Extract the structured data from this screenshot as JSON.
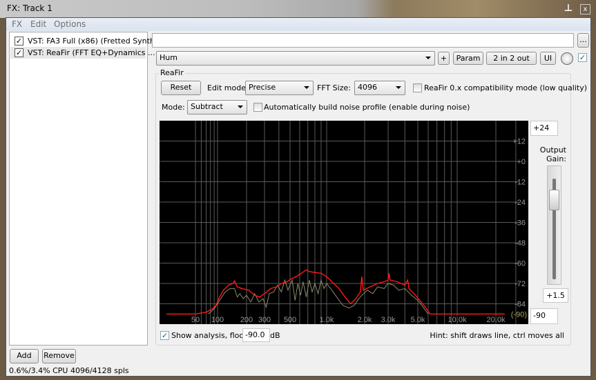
{
  "window": {
    "title": "FX: Track 1",
    "pin_icon": "pin-icon",
    "close_icon": "close-icon"
  },
  "menu": [
    "FX",
    "Edit",
    "Options"
  ],
  "fx_chain": [
    {
      "label": "VST: FA3 Full (x86) (Fretted Synth)",
      "enabled": true
    },
    {
      "label": "VST: ReaFir (FFT EQ+Dynamics ...",
      "enabled": true,
      "selected": true
    }
  ],
  "buttons": {
    "add": "Add",
    "remove": "Remove",
    "more": "...",
    "plus": "+",
    "param": "Param",
    "io": "2 in 2 out",
    "ui": "UI"
  },
  "preset_name": "",
  "preset": "Hum",
  "plugin_enabled": true,
  "reafir": {
    "group_label": "ReaFir",
    "reset": "Reset",
    "edit_mode_label": "Edit mode:",
    "edit_mode": "Precise",
    "fft_size_label": "FFT Size:",
    "fft_size": "4096",
    "compat_label": "ReaFir 0.x compatibility mode (low quality)",
    "compat_checked": false,
    "mode_label": "Mode:",
    "mode": "Subtract",
    "auto_noise_label": "Automatically build noise profile (enable during noise)",
    "auto_noise_checked": false,
    "range_top": "+24",
    "range_bottom": "-90",
    "output_gain_label": "Output Gain:",
    "output_gain": "+1.5",
    "output_gain_db": 1.5,
    "show_analysis_label": "Show analysis, floor:",
    "show_analysis_checked": true,
    "floor": "-90.0",
    "floor_unit": "dB",
    "hint": "Hint: shift draws line, ctrl moves all"
  },
  "chart_data": {
    "type": "line",
    "x_scale": "log",
    "x_ticks": [
      "50",
      "100",
      "200",
      "300",
      "500",
      "1.0k",
      "2.0k",
      "3.0k",
      "5.0k",
      "10.0k",
      "20.0k"
    ],
    "y_ticks": [
      "+12",
      "+0",
      "-12",
      "-24",
      "-36",
      "-48",
      "-60",
      "-72",
      "-84"
    ],
    "floor_label": "(-90)",
    "ylim": [
      -96,
      24
    ],
    "grid": true,
    "colors": {
      "background": "#000000",
      "grid": "#5a5a5a",
      "eq_curve": "#ff1a1a",
      "analysis": "#8c8a6e",
      "floor_label": "#a8a060"
    },
    "series": [
      {
        "key": "eq_curve",
        "points": [
          [
            20,
            -90
          ],
          [
            50,
            -90
          ],
          [
            70,
            -89
          ],
          [
            85,
            -87
          ],
          [
            95,
            -85
          ],
          [
            105,
            -80
          ],
          [
            115,
            -76
          ],
          [
            130,
            -73
          ],
          [
            145,
            -72
          ],
          [
            150,
            -70.5
          ],
          [
            160,
            -74
          ],
          [
            180,
            -75
          ],
          [
            210,
            -76
          ],
          [
            240,
            -79
          ],
          [
            270,
            -80
          ],
          [
            300,
            -78
          ],
          [
            340,
            -75
          ],
          [
            380,
            -74
          ],
          [
            420,
            -72
          ],
          [
            470,
            -71
          ],
          [
            520,
            -69
          ],
          [
            560,
            -68
          ],
          [
            620,
            -66
          ],
          [
            680,
            -64
          ],
          [
            720,
            -65
          ],
          [
            800,
            -65.5
          ],
          [
            900,
            -66
          ],
          [
            1000,
            -68
          ],
          [
            1100,
            -71
          ],
          [
            1250,
            -75
          ],
          [
            1400,
            -80
          ],
          [
            1550,
            -84
          ],
          [
            1700,
            -81
          ],
          [
            1850,
            -77
          ],
          [
            1900,
            -68
          ],
          [
            1950,
            -76
          ],
          [
            2200,
            -74
          ],
          [
            2500,
            -72
          ],
          [
            2800,
            -71
          ],
          [
            3000,
            -70
          ],
          [
            3050,
            -66
          ],
          [
            3100,
            -70
          ],
          [
            3500,
            -71
          ],
          [
            4000,
            -73
          ],
          [
            4200,
            -70
          ],
          [
            4300,
            -75
          ],
          [
            4800,
            -79
          ],
          [
            5300,
            -83
          ],
          [
            5700,
            -86
          ],
          [
            6200,
            -90
          ],
          [
            20000,
            -90
          ],
          [
            24000,
            -90
          ]
        ]
      },
      {
        "key": "analysis",
        "points": [
          [
            75,
            -90
          ],
          [
            90,
            -87
          ],
          [
            105,
            -82
          ],
          [
            120,
            -77
          ],
          [
            135,
            -75
          ],
          [
            150,
            -75
          ],
          [
            160,
            -80
          ],
          [
            170,
            -78
          ],
          [
            185,
            -81
          ],
          [
            200,
            -79
          ],
          [
            220,
            -83
          ],
          [
            240,
            -78
          ],
          [
            265,
            -83
          ],
          [
            290,
            -81
          ],
          [
            310,
            -86
          ],
          [
            330,
            -78
          ],
          [
            360,
            -77
          ],
          [
            390,
            -73
          ],
          [
            420,
            -77
          ],
          [
            450,
            -70
          ],
          [
            480,
            -76
          ],
          [
            520,
            -70
          ],
          [
            550,
            -82
          ],
          [
            580,
            -72
          ],
          [
            610,
            -79
          ],
          [
            640,
            -71
          ],
          [
            680,
            -80
          ],
          [
            720,
            -70
          ],
          [
            760,
            -77
          ],
          [
            800,
            -72
          ],
          [
            850,
            -78
          ],
          [
            900,
            -70
          ],
          [
            950,
            -75
          ],
          [
            1000,
            -72
          ],
          [
            1100,
            -76
          ],
          [
            1200,
            -80
          ],
          [
            1350,
            -85
          ],
          [
            1500,
            -86.5
          ],
          [
            1650,
            -85
          ],
          [
            1800,
            -81
          ],
          [
            1950,
            -78
          ],
          [
            2100,
            -76
          ],
          [
            2300,
            -78
          ],
          [
            2500,
            -74
          ],
          [
            2800,
            -75
          ],
          [
            3000,
            -72
          ],
          [
            3300,
            -73
          ],
          [
            3600,
            -76
          ],
          [
            4000,
            -75
          ],
          [
            4500,
            -79
          ],
          [
            5000,
            -82
          ],
          [
            5500,
            -86
          ],
          [
            6000,
            -90
          ]
        ]
      }
    ]
  }
}
